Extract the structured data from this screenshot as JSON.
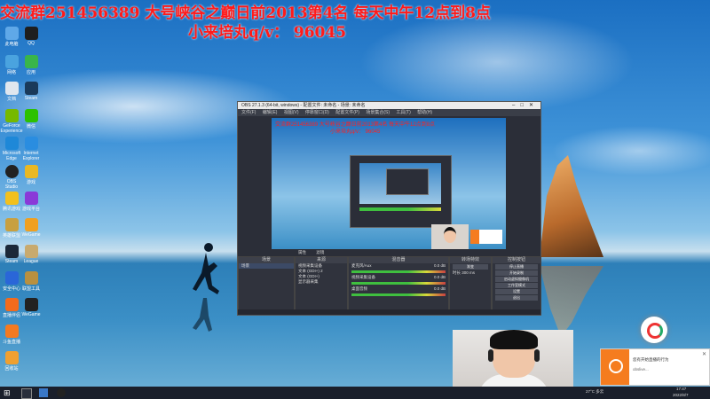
{
  "banner": {
    "line1": "交流群251456389 大号峡谷之巅日前2013第4名 每天中午12点到8点",
    "line2": "小来培丸q/v： 96045"
  },
  "desktop_icons": [
    {
      "label": "此电脑",
      "color": "#5fa8e8"
    },
    {
      "label": "QQ",
      "color": "#1e1e1e"
    },
    {
      "label": "网络",
      "color": "#4aa3df"
    },
    {
      "label": "应用",
      "color": "#39b54a"
    },
    {
      "label": "文档",
      "color": "#dfe6ee"
    },
    {
      "label": "Steam",
      "color": "#1a3a5a"
    },
    {
      "label": "GeForce Experience",
      "color": "#76b900"
    },
    {
      "label": "微信",
      "color": "#2dc100"
    },
    {
      "label": "Microsoft Edge",
      "color": "#1e88d8"
    },
    {
      "label": "Internet Explorer",
      "color": "#2a8de0"
    },
    {
      "label": "OBS Studio",
      "color": "#222222"
    },
    {
      "label": "游戏",
      "color": "#e9b823"
    },
    {
      "label": "腾讯游戏",
      "color": "#f2c01e"
    },
    {
      "label": "游戏平台",
      "color": "#8a3ad8"
    },
    {
      "label": "英雄联盟",
      "color": "#c8a040"
    },
    {
      "label": "WeGame",
      "color": "#f0a020"
    },
    {
      "label": "Steam",
      "color": "#1b2838"
    },
    {
      "label": "League",
      "color": "#c8aa6e"
    },
    {
      "label": "安全中心",
      "color": "#2a66d8"
    },
    {
      "label": "联盟工具",
      "color": "#b89040"
    },
    {
      "label": "直播伴侣",
      "color": "#f26b1d"
    },
    {
      "label": "WeGame",
      "color": "#222222"
    },
    {
      "label": "斗鱼直播",
      "color": "#f47a20"
    },
    {
      "label": "回收站",
      "color": "#f0a030"
    }
  ],
  "obs": {
    "title": "OBS 27.1.3 (64-bit, windows) - 配置文件: 未命名 - 场景: 未命名",
    "menu": [
      "文件(F)",
      "编辑(E)",
      "视图(V)",
      "停靠窗口(D)",
      "配置文件(P)",
      "场景集合(S)",
      "工具(T)",
      "帮助(H)"
    ],
    "preview_text1": "交流群251456389 大号峡谷之巅日前2013第4名 每天中午12点到8点",
    "preview_text2": "小来培丸q/v： 96045",
    "toolbar": {
      "properties": "属性",
      "filters": "滤镜"
    },
    "scenes_header": "场景",
    "scenes": [
      "场景"
    ],
    "sources_header": "来源",
    "sources": [
      "视频采集设备",
      "文本 (GDI+) 2",
      "文本 (GDI+)",
      "显示器采集"
    ],
    "mixer_header": "混音器",
    "mixer": [
      {
        "name": "麦克风/Aux",
        "level": "0.0 dB"
      },
      {
        "name": "视频采集设备",
        "level": "0.0 dB"
      },
      {
        "name": "桌面音频",
        "level": "0.0 dB"
      }
    ],
    "transitions_header": "转场特效",
    "transition_name": "渐变",
    "duration_label": "时长",
    "duration_value": "300 ms",
    "controls_header": "控制按钮",
    "controls": [
      "停止直播",
      "开始录制",
      "启动虚拟摄像机",
      "工作室模式",
      "设置",
      "退出"
    ]
  },
  "notification": {
    "title": "您有开始直播的行为",
    "subtitle": "obslive..."
  },
  "taskbar": {
    "weather": "27°C 多云",
    "time": "17:47",
    "date": "2022/8/7"
  }
}
